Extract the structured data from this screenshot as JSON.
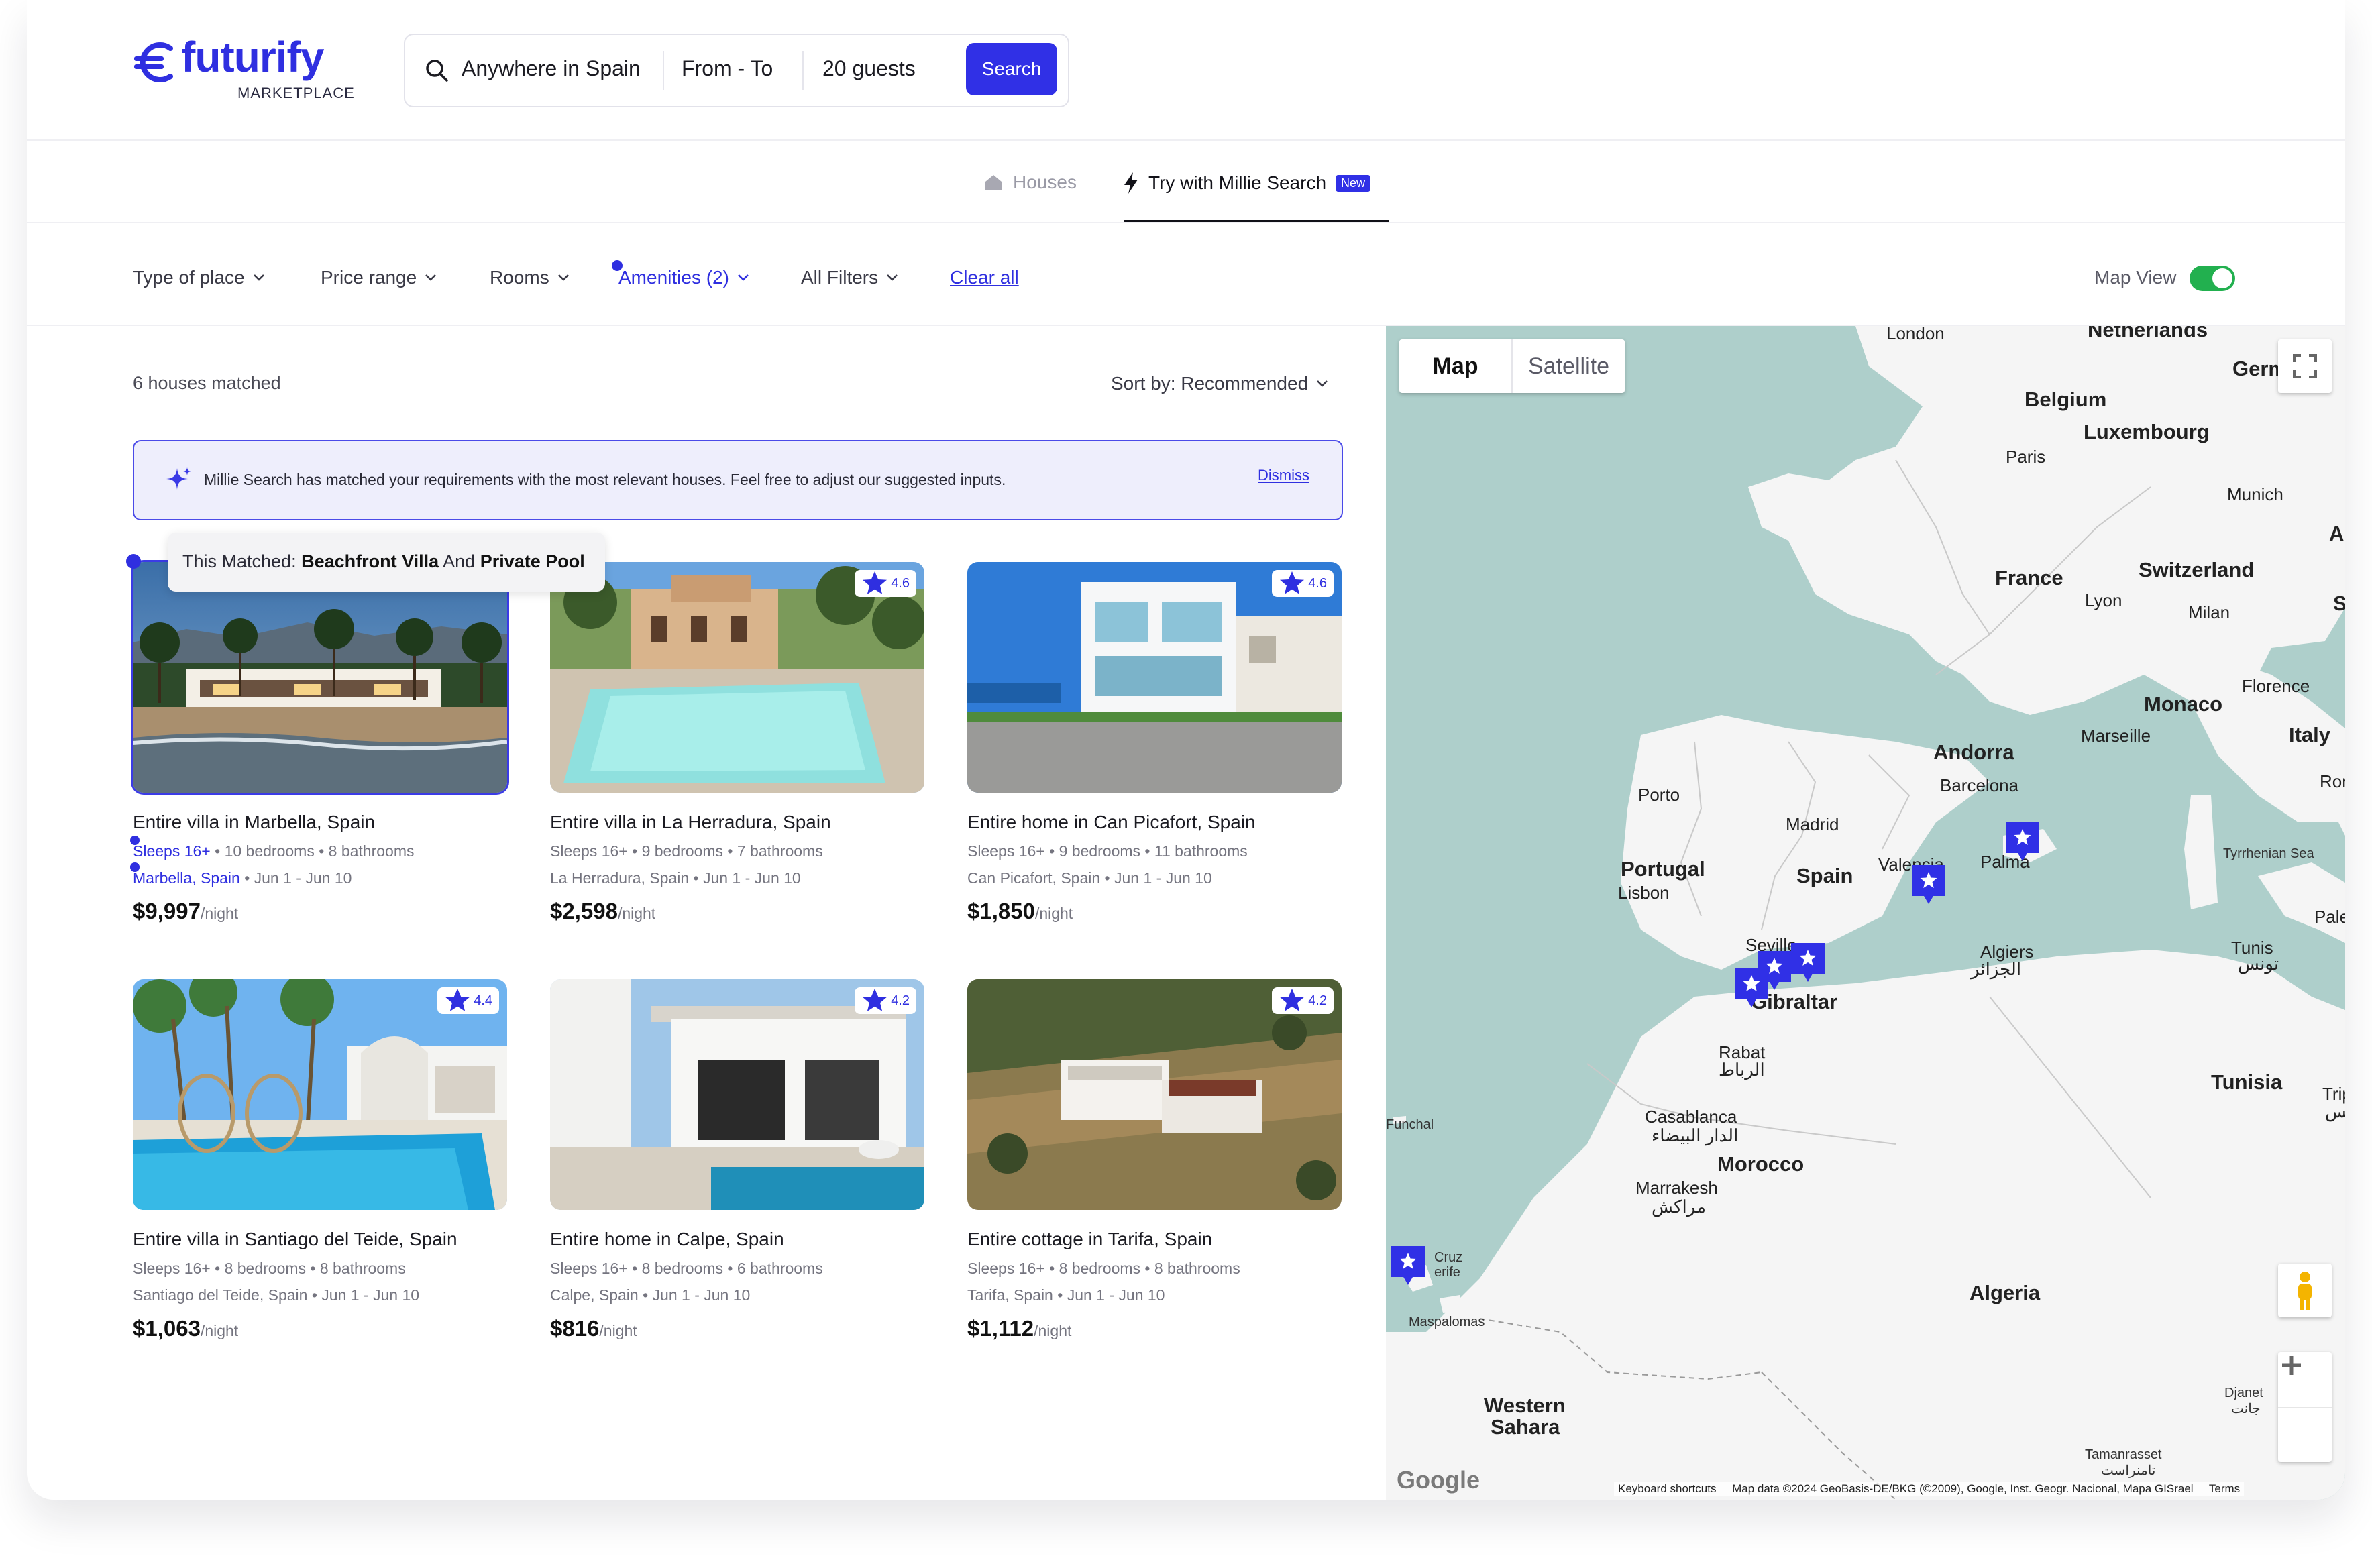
{
  "brand": {
    "name": "futurify",
    "subtitle": "MARKETPLACE",
    "color": "#2f2fe0"
  },
  "search": {
    "location": "Anywhere in Spain",
    "dates": "From - To",
    "guests": "20 guests",
    "button": "Search"
  },
  "tabs": [
    {
      "label": "Houses",
      "icon": "house-icon",
      "active": false
    },
    {
      "label": "Try with Millie Search",
      "icon": "lightning-icon",
      "badge": "New",
      "active": true
    }
  ],
  "filters": {
    "items": [
      {
        "label": "Type of place"
      },
      {
        "label": "Price range"
      },
      {
        "label": "Rooms"
      },
      {
        "label": "Amenities (2)",
        "active": true
      },
      {
        "label": "All Filters"
      }
    ],
    "clear_all": "Clear all",
    "map_view_label": "Map View",
    "map_view_on": true
  },
  "results": {
    "count_text": "6 houses matched",
    "sort_label": "Sort by: Recommended"
  },
  "banner": {
    "text": "Millie Search has matched your requirements with the most relevant houses. Feel free to adjust our suggested inputs.",
    "dismiss": "Dismiss"
  },
  "tooltip": {
    "prefix": "This Matched: ",
    "match1": "Beachfront Villa",
    "joiner": " And ",
    "match2": "Private Pool"
  },
  "listings": [
    {
      "title": "Entire villa in Marbella, Spain",
      "sleeps": "Sleeps 16+",
      "rooms": " • 10 bedrooms • 8 bathrooms",
      "place": "Marbella, Spain",
      "dates": " • Jun 1 - Jun 10",
      "price": "$9,997",
      "unit": "/night",
      "rating": ""
    },
    {
      "title": "Entire villa in La Herradura, Spain",
      "sleeps": "Sleeps 16+",
      "rooms": " • 9 bedrooms • 7 bathrooms",
      "place": "La Herradura, Spain",
      "dates": " • Jun 1 - Jun 10",
      "price": "$2,598",
      "unit": "/night",
      "rating": "4.6"
    },
    {
      "title": "Entire home in Can Picafort, Spain",
      "sleeps": "Sleeps 16+",
      "rooms": " • 9 bedrooms • 11 bathrooms",
      "place": "Can Picafort, Spain",
      "dates": " • Jun 1 - Jun 10",
      "price": "$1,850",
      "unit": "/night",
      "rating": "4.6"
    },
    {
      "title": "Entire villa in Santiago del Teide, Spain",
      "sleeps": "Sleeps 16+",
      "rooms": " • 8 bedrooms • 8 bathrooms",
      "place": "Santiago del Teide, Spain",
      "dates": " • Jun 1 - Jun 10",
      "price": "$1,063",
      "unit": "/night",
      "rating": "4.4"
    },
    {
      "title": "Entire home in Calpe, Spain",
      "sleeps": "Sleeps 16+",
      "rooms": " • 8 bedrooms • 6 bathrooms",
      "place": "Calpe, Spain",
      "dates": " • Jun 1 - Jun 10",
      "price": "$816",
      "unit": "/night",
      "rating": "4.2"
    },
    {
      "title": "Entire cottage in Tarifa, Spain",
      "sleeps": "Sleeps 16+",
      "rooms": " • 8 bedrooms • 8 bathrooms",
      "place": "Tarifa, Spain",
      "dates": " • Jun 1 - Jun 10",
      "price": "$1,112",
      "unit": "/night",
      "rating": "4.2"
    }
  ],
  "map": {
    "type_map": "Map",
    "type_satellite": "Satellite",
    "footer_shortcuts": "Keyboard shortcuts",
    "footer_data": "Map data ©2024 GeoBasis-DE/BKG (©2009), Google, Inst. Geogr. Nacional, Mapa GISrael",
    "footer_terms": "Terms",
    "google": "Google",
    "labels": {
      "netherlands": "Netherlands",
      "london": "London",
      "germany": "Germany",
      "belgium": "Belgium",
      "luxembourg": "Luxembourg",
      "paris": "Paris",
      "munich": "Munich",
      "austria": "Au",
      "france": "France",
      "switzerland": "Switzerland",
      "lyon": "Lyon",
      "milan": "Milan",
      "slovenia": "S",
      "monaco": "Monaco",
      "florence": "Florence",
      "marseille": "Marseille",
      "italy": "Italy",
      "andorra": "Andorra",
      "rome": "Ron",
      "barcelona": "Barcelona",
      "porto": "Porto",
      "madrid": "Madrid",
      "portugal": "Portugal",
      "spain": "Spain",
      "valencia": "Valencia",
      "palma": "Palma",
      "tyrrhenian": "Tyrrhenian Sea",
      "lisbon": "Lisbon",
      "palermo": "Paler",
      "seville": "Seville",
      "algiers": "Algiers",
      "algiers_ar": "الجزائر",
      "tunis": "Tunis",
      "tunis_ar": "تونس",
      "gibraltar": "Gibraltar",
      "rabat": "Rabat",
      "rabat_ar": "الرباط",
      "tunisia": "Tunisia",
      "tripoli": "Tripo",
      "tripoli_ar": "طرابلس",
      "funchal": "Funchal",
      "casablanca": "Casablanca",
      "casablanca_ar": "الدار البيضاء",
      "morocco": "Morocco",
      "marrakesh": "Marrakesh",
      "marrakesh_ar": "مراكش",
      "santa_cruz": "Cruz",
      "tenerife": "erife",
      "algeria": "Algeria",
      "maspalomas": "Maspalomas",
      "western_sahara_1": "Western",
      "western_sahara_2": "Sahara",
      "djanet": "Djanet",
      "djanet_ar": "جانت",
      "tamanrasset": "Tamanrasset",
      "tamanrasset_ar": "تامنراست"
    }
  }
}
